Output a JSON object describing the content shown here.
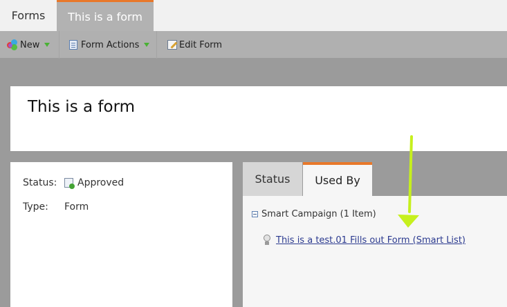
{
  "tabs": {
    "forms_label": "Forms",
    "active_label": "This is a form"
  },
  "toolbar": {
    "new_label": "New",
    "form_actions_label": "Form Actions",
    "edit_form_label": "Edit Form"
  },
  "page": {
    "title": "This is a form"
  },
  "details": {
    "status_key": "Status:",
    "status_value": "Approved",
    "type_key": "Type:",
    "type_value": "Form"
  },
  "right_tabs": {
    "status_label": "Status",
    "used_by_label": "Used By"
  },
  "used_by": {
    "group_label": "Smart Campaign (1 Item)",
    "item_link": "This is a test.01 Fills out Form (Smart List)"
  },
  "colors": {
    "accent": "#e8782a",
    "arrow": "#c6f01d",
    "dropdown_triangle": "#49b234",
    "link": "#2b3a8f"
  },
  "icons": {
    "new": "multicolor-circles-icon",
    "form_actions": "form-document-icon",
    "edit_form": "edit-pencil-icon",
    "approved": "approved-document-icon",
    "collapse": "collapse-minus-icon",
    "leaf": "lightbulb-icon"
  }
}
